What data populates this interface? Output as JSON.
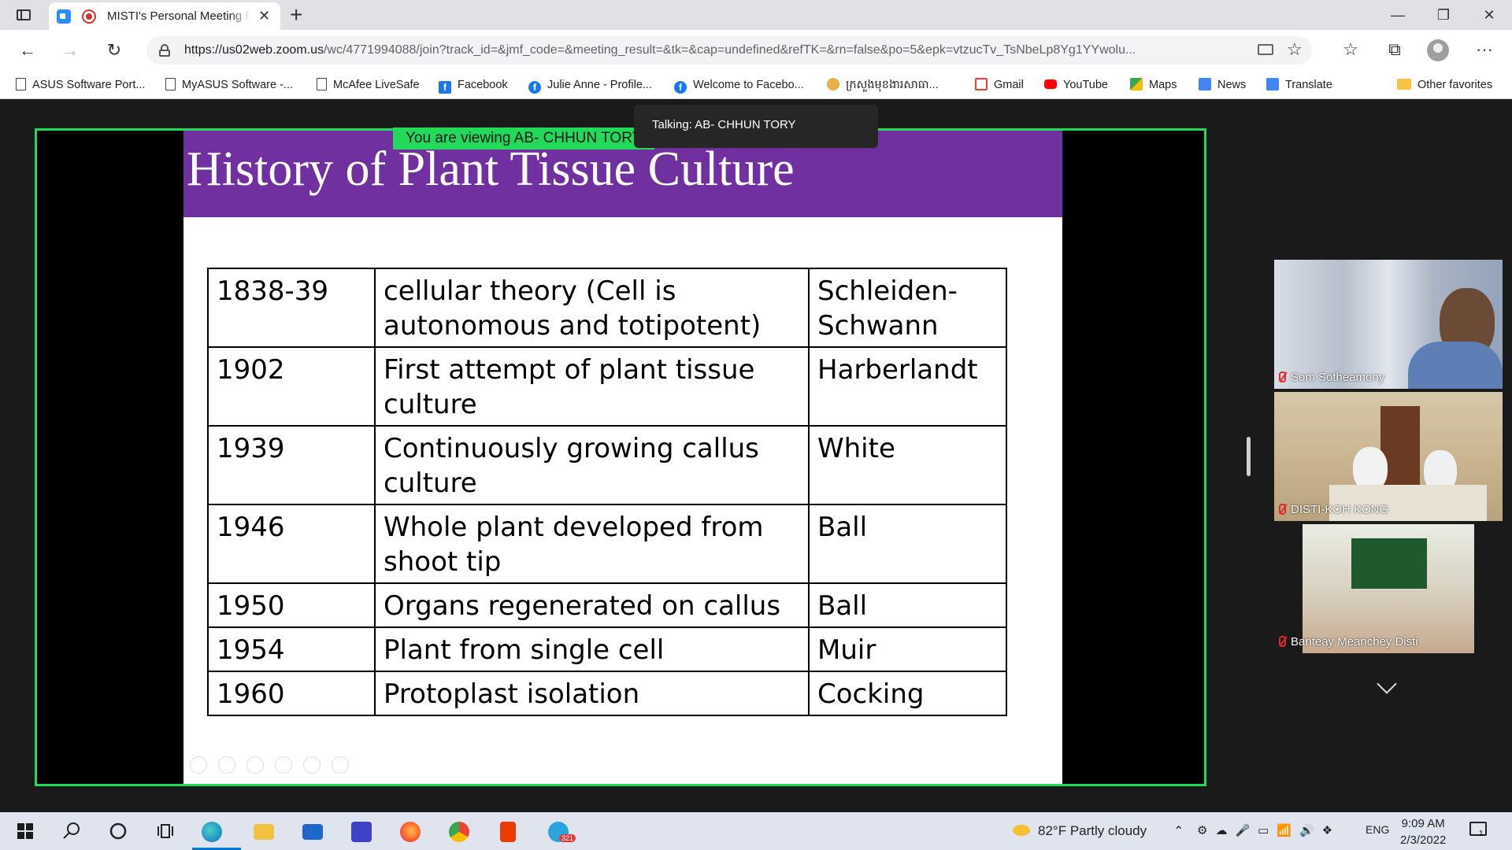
{
  "browser": {
    "tab_title": "MISTI's Personal Meeting Ro",
    "close_glyph": "✕",
    "new_tab_glyph": "+",
    "url_host": "https://us02web.zoom.us",
    "url_rest": "/wc/4771994088/join?track_id=&jmf_code=&meeting_result=&tk=&cap=undefined&refTK=&rn=false&po=5&epk=vtzucTv_TsNbeLp8Yg1YYwolu...",
    "nav": {
      "back": "←",
      "forward": "→",
      "reload": "↻"
    },
    "toolbar": {
      "favorites": "☆",
      "collections": "⧉",
      "more": "···"
    },
    "window": {
      "minimize": "—",
      "restore": "❐",
      "close": "✕"
    }
  },
  "favorites": [
    {
      "label": "ASUS Software Port...",
      "icon": "page-icon"
    },
    {
      "label": "MyASUS Software -...",
      "icon": "page-icon"
    },
    {
      "label": "McAfee LiveSafe",
      "icon": "page-icon"
    },
    {
      "label": "Facebook",
      "icon": "facebook-icon",
      "glyph": "f"
    },
    {
      "label": "Julie Anne - Profile...",
      "icon": "facebook-icon",
      "glyph": "f"
    },
    {
      "label": "Welcome to Facebo...",
      "icon": "facebook-icon",
      "glyph": "f"
    },
    {
      "label": "ក្រសួងមុខងារសាធា...",
      "icon": "ministry-icon"
    },
    {
      "label": "Gmail",
      "icon": "gmail-icon"
    },
    {
      "label": "YouTube",
      "icon": "youtube-icon"
    },
    {
      "label": "Maps",
      "icon": "maps-icon"
    },
    {
      "label": "News",
      "icon": "news-icon"
    },
    {
      "label": "Translate",
      "icon": "translate-icon"
    },
    {
      "label": "Other favorites",
      "icon": "folder-icon"
    }
  ],
  "meeting": {
    "viewing_badge": "You are viewing AB- CHHUN TORY",
    "talking": "Talking: AB- CHHUN TORY",
    "slide": {
      "title": "History of Plant Tissue Culture",
      "rows": [
        {
          "year": "1838-39",
          "event": " cellular theory (Cell is autonomous and totipotent)",
          "person": "Schleiden-Schwann"
        },
        {
          "year": "1902",
          "event": " First attempt of plant tissue culture",
          "person": "Harberlandt"
        },
        {
          "year": "1939",
          "event": "Continuously growing callus culture",
          "person": "White"
        },
        {
          "year": "1946",
          "event": "Whole plant developed from shoot tip",
          "person": "Ball"
        },
        {
          "year": "1950",
          "event": "Organs regenerated on callus",
          "person": "Ball"
        },
        {
          "year": "1954",
          "event": "Plant from single cell",
          "person": "Muir"
        },
        {
          "year": "1960",
          "event": "Protoplast isolation",
          "person": "Cocking"
        }
      ]
    },
    "participants": [
      {
        "name": "Som Sotheamony",
        "muted": true
      },
      {
        "name": "DISTI-KOH KONG",
        "muted": true
      },
      {
        "name": "Banteay Meanchey Disti",
        "muted": true
      }
    ]
  },
  "taskbar": {
    "weather": "82°F  Partly cloudy",
    "language": "ENG",
    "time": "9:09 AM",
    "date": "2/3/2022",
    "notification_count": "1",
    "telegram_badge": "321"
  },
  "colors": {
    "accent_green": "#23d959",
    "slide_header": "#7030a0"
  }
}
